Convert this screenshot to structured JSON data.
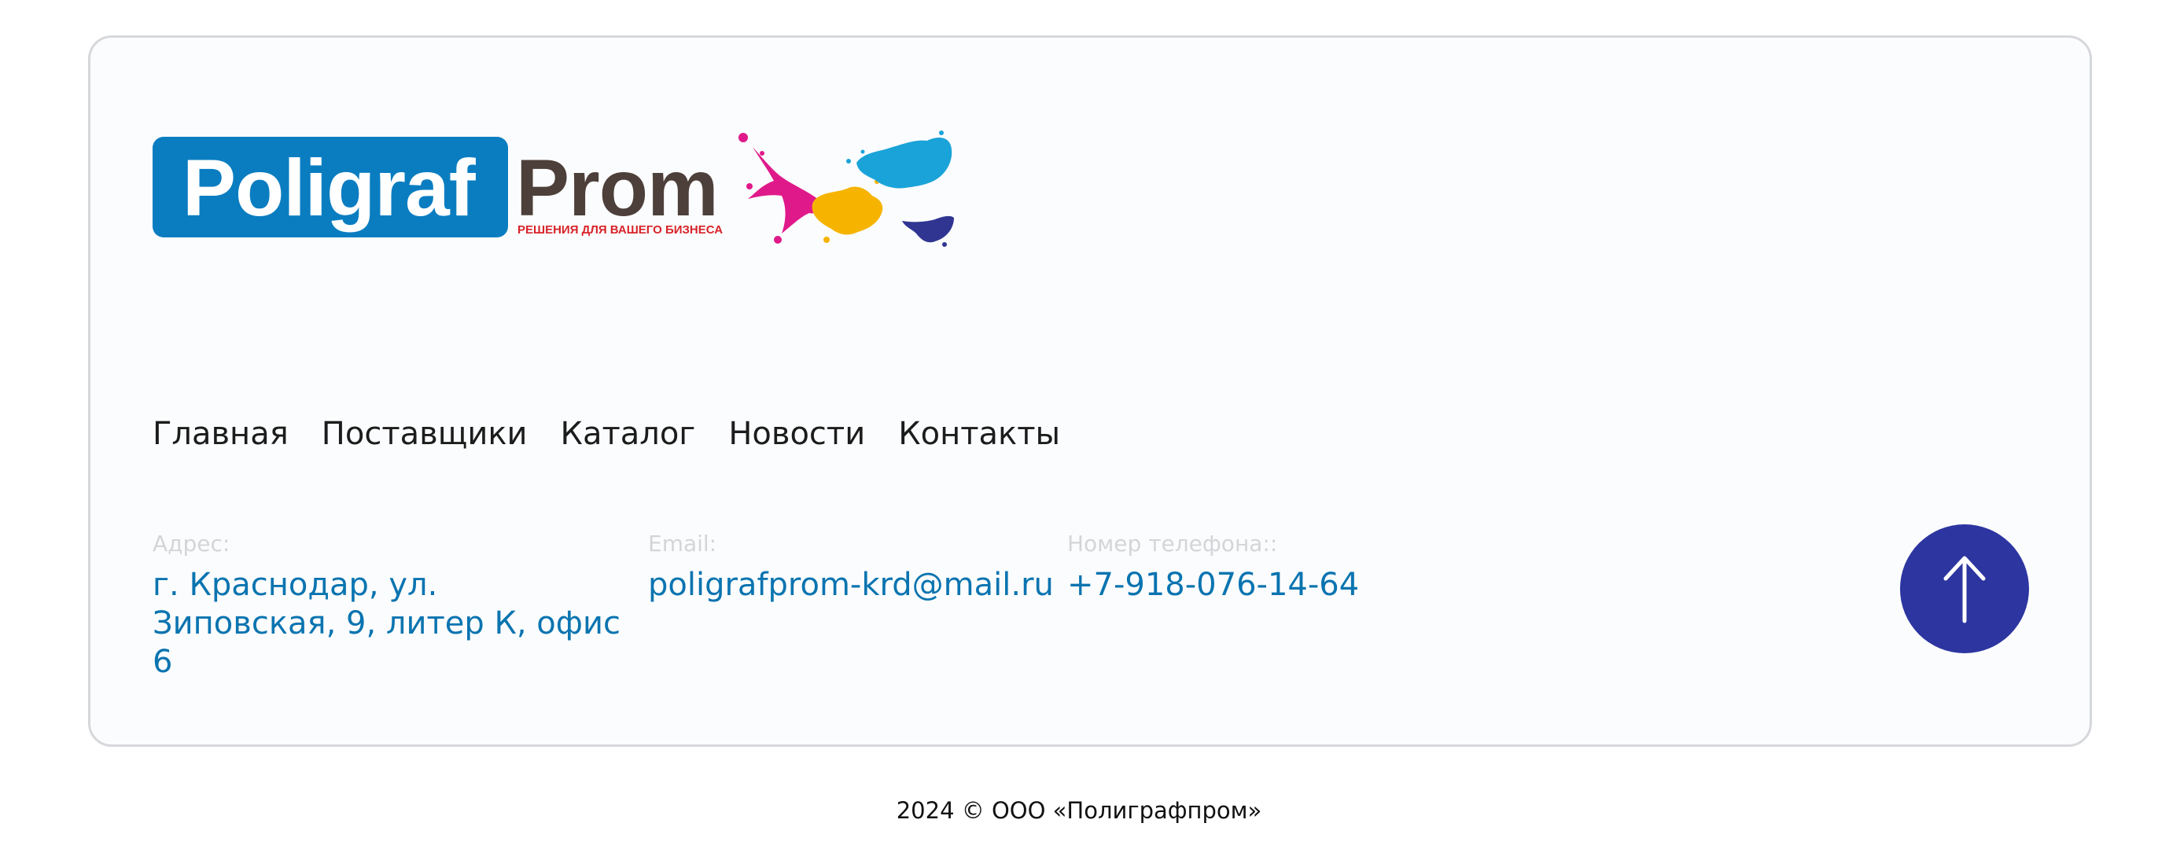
{
  "logo": {
    "word_primary": "Poligraf",
    "word_secondary": "Prom",
    "tagline": "РЕШЕНИЯ ДЛЯ ВАШЕГО БИЗНЕСА",
    "colors": {
      "brand_blue": "#0a7dc1",
      "brand_dark": "#4d3f3a",
      "tagline_red": "#d8232a",
      "splash_magenta": "#e0198a",
      "splash_yellow": "#f6b400",
      "splash_cyan": "#1aa3d9",
      "splash_navy": "#2f3591"
    }
  },
  "nav": {
    "items": [
      {
        "label": "Главная"
      },
      {
        "label": "Поставщики"
      },
      {
        "label": "Каталог"
      },
      {
        "label": "Новости"
      },
      {
        "label": "Контакты"
      }
    ]
  },
  "contacts": {
    "address": {
      "label": "Адрес:",
      "value": "г. Краснодар, ул. Зиповская, 9, литер К, офис 6"
    },
    "email": {
      "label": "Email:",
      "value": "poligrafprom-krd@mail.ru"
    },
    "phone": {
      "label": "Номер телефона::",
      "value": "+7-918-076-14-64"
    }
  },
  "scroll_top": {
    "icon": "arrow-up-icon",
    "color": "#2c35a0"
  },
  "footer": {
    "copyright": "2024 © ООО «Полиграфпром»"
  },
  "colors": {
    "link": "#0a74b0",
    "label_muted": "#d4d5d8",
    "card_border": "#d6d8db",
    "card_background": "#fbfcfd"
  }
}
